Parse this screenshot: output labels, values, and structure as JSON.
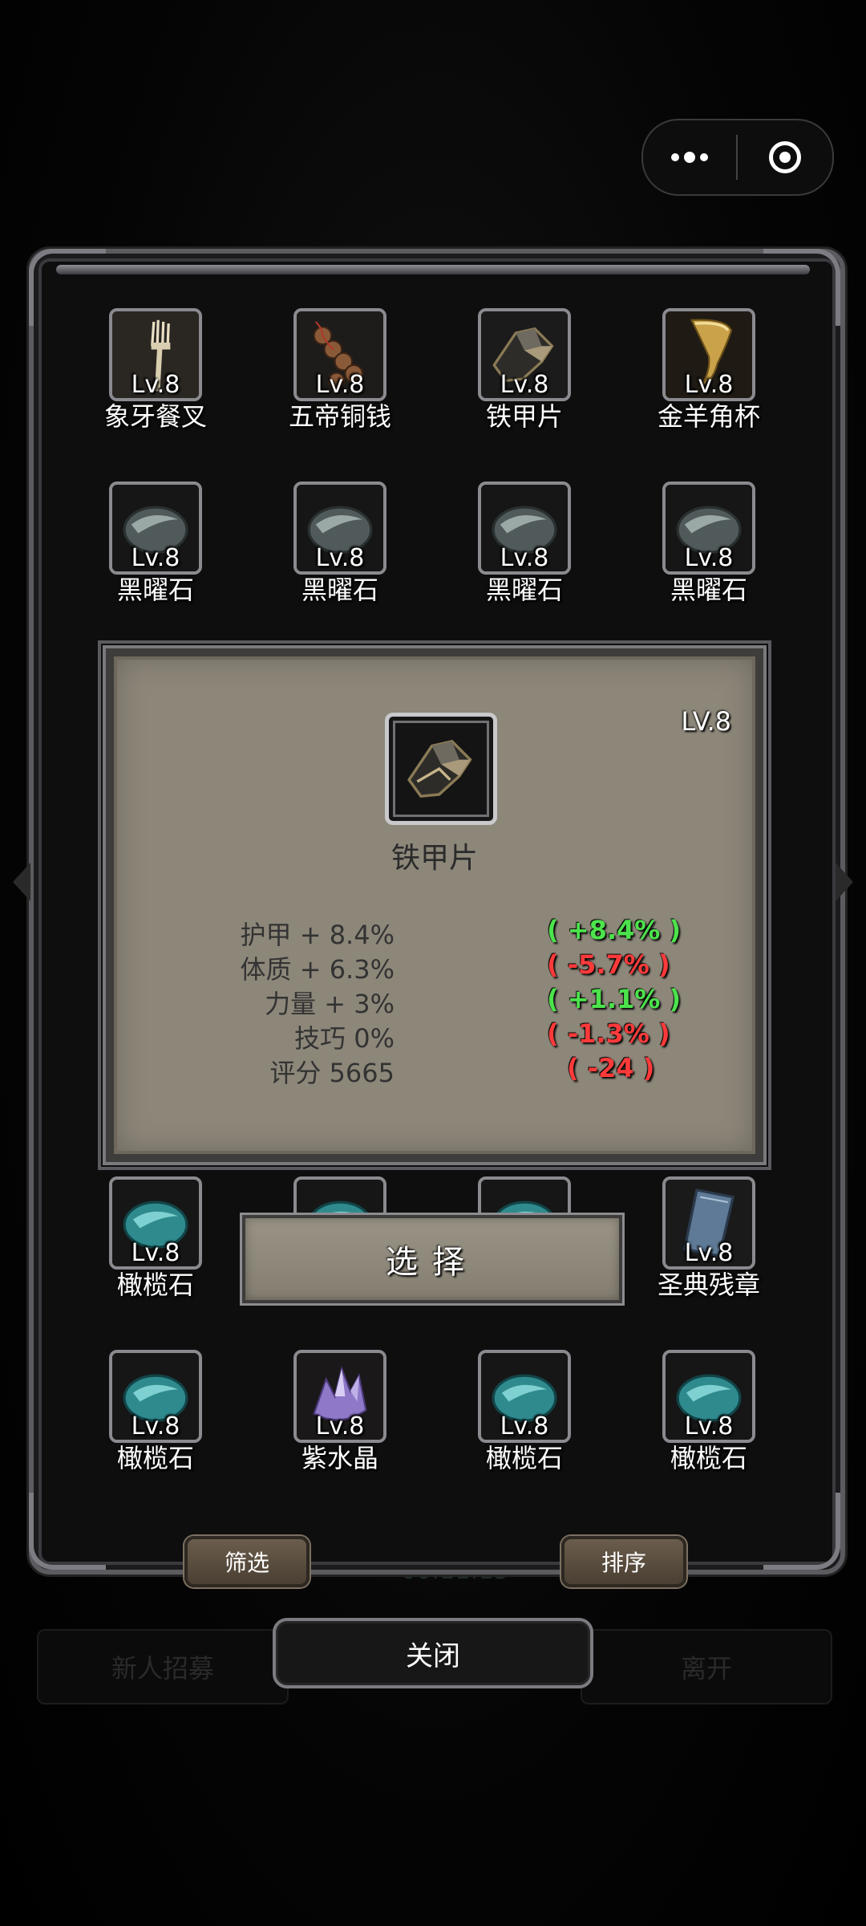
{
  "capsule": {
    "more_icon": "more-dots-icon",
    "close_icon": "target-close-icon"
  },
  "background": {
    "left_button": "新人招募",
    "right_button": "离开",
    "timer": "00:11:15"
  },
  "items": [
    {
      "level": "Lv.8",
      "name": "象牙餐叉",
      "icon": "fork"
    },
    {
      "level": "Lv.8",
      "name": "五帝铜钱",
      "icon": "coins"
    },
    {
      "level": "Lv.8",
      "name": "铁甲片",
      "icon": "armor-shard"
    },
    {
      "level": "Lv.8",
      "name": "金羊角杯",
      "icon": "horn-cup"
    },
    {
      "level": "Lv.8",
      "name": "黑曜石",
      "icon": "obsidian"
    },
    {
      "level": "Lv.8",
      "name": "黑曜石",
      "icon": "obsidian"
    },
    {
      "level": "Lv.8",
      "name": "黑曜石",
      "icon": "obsidian"
    },
    {
      "level": "Lv.8",
      "name": "黑曜石",
      "icon": "obsidian"
    },
    {
      "level": "Lv.8",
      "name": "橄榄石",
      "icon": "olivine"
    },
    {
      "level": "",
      "name": "",
      "icon": "olivine"
    },
    {
      "level": "",
      "name": "",
      "icon": "olivine"
    },
    {
      "level": "Lv.8",
      "name": "圣典残章",
      "icon": "scripture"
    },
    {
      "level": "Lv.8",
      "name": "橄榄石",
      "icon": "olivine"
    },
    {
      "level": "Lv.8",
      "name": "紫水晶",
      "icon": "amethyst"
    },
    {
      "level": "Lv.8",
      "name": "橄榄石",
      "icon": "olivine"
    },
    {
      "level": "Lv.8",
      "name": "橄榄石",
      "icon": "olivine"
    }
  ],
  "detail": {
    "level": "LV.8",
    "name": "铁甲片",
    "icon": "armor-shard",
    "stats": [
      {
        "label": "护甲 + 8.4%",
        "delta": "( +8.4% )",
        "positive": true
      },
      {
        "label": "体质 + 6.3%",
        "delta": "( -5.7% )",
        "positive": false
      },
      {
        "label": "力量 + 3%",
        "delta": "( +1.1% )",
        "positive": true
      },
      {
        "label": "技巧  0%",
        "delta": "( -1.3% )",
        "positive": false
      },
      {
        "label": "评分 5665",
        "delta": "( -24 )",
        "positive": false
      }
    ]
  },
  "buttons": {
    "select": "选择",
    "filter": "筛选",
    "sort": "排序",
    "close": "关闭"
  },
  "colors": {
    "positive": "#4ce34c",
    "negative": "#ff3a3a",
    "card": "#8d877a"
  }
}
